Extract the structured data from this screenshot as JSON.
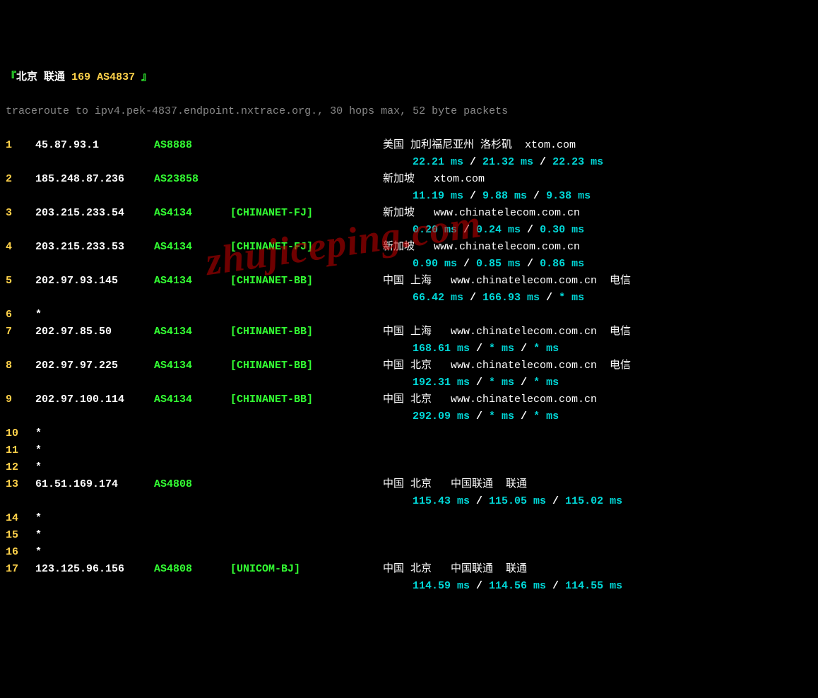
{
  "header": {
    "open": "『",
    "city": "北京",
    "isp": "联通",
    "asn_num": "169",
    "asn_label": "AS4837",
    "close": "』"
  },
  "cmd": "traceroute to ipv4.pek-4837.endpoint.nxtrace.org., 30 hops max, 52 byte packets",
  "watermark": "zhujiceping.com",
  "hops": [
    {
      "n": "1",
      "ip": "45.87.93.1",
      "asn": "AS8888",
      "net": "",
      "loc": "美国 加利福尼亚州 洛杉矶  xtom.com",
      "rtt": [
        "22.21 ms",
        "21.32 ms",
        "22.23 ms"
      ]
    },
    {
      "n": "2",
      "ip": "185.248.87.236",
      "asn": "AS23858",
      "net": "",
      "loc": "新加坡   xtom.com",
      "rtt": [
        "11.19 ms",
        "9.88 ms",
        "9.38 ms"
      ]
    },
    {
      "n": "3",
      "ip": "203.215.233.54",
      "asn": "AS4134",
      "net": "[CHINANET-FJ]",
      "loc": "新加坡   www.chinatelecom.com.cn",
      "rtt": [
        "0.20 ms",
        "0.24 ms",
        "0.30 ms"
      ]
    },
    {
      "n": "4",
      "ip": "203.215.233.53",
      "asn": "AS4134",
      "net": "[CHINANET-FJ]",
      "loc": "新加坡   www.chinatelecom.com.cn",
      "rtt": [
        "0.90 ms",
        "0.85 ms",
        "0.86 ms"
      ]
    },
    {
      "n": "5",
      "ip": "202.97.93.145",
      "asn": "AS4134",
      "net": "[CHINANET-BB]",
      "loc": "中国 上海   www.chinatelecom.com.cn  电信",
      "rtt": [
        "66.42 ms",
        "166.93 ms",
        "* ms"
      ]
    },
    {
      "n": "6",
      "ip": "*",
      "asn": "",
      "net": "",
      "loc": "",
      "rtt": null
    },
    {
      "n": "7",
      "ip": "202.97.85.50",
      "asn": "AS4134",
      "net": "[CHINANET-BB]",
      "loc": "中国 上海   www.chinatelecom.com.cn  电信",
      "rtt": [
        "168.61 ms",
        "* ms",
        "* ms"
      ]
    },
    {
      "n": "8",
      "ip": "202.97.97.225",
      "asn": "AS4134",
      "net": "[CHINANET-BB]",
      "loc": "中国 北京   www.chinatelecom.com.cn  电信",
      "rtt": [
        "192.31 ms",
        "* ms",
        "* ms"
      ]
    },
    {
      "n": "9",
      "ip": "202.97.100.114",
      "asn": "AS4134",
      "net": "[CHINANET-BB]",
      "loc": "中国 北京   www.chinatelecom.com.cn",
      "rtt": [
        "292.09 ms",
        "* ms",
        "* ms"
      ]
    },
    {
      "n": "10",
      "ip": "*",
      "asn": "",
      "net": "",
      "loc": "",
      "rtt": null
    },
    {
      "n": "11",
      "ip": "*",
      "asn": "",
      "net": "",
      "loc": "",
      "rtt": null
    },
    {
      "n": "12",
      "ip": "*",
      "asn": "",
      "net": "",
      "loc": "",
      "rtt": null
    },
    {
      "n": "13",
      "ip": "61.51.169.174",
      "asn": "AS4808",
      "net": "",
      "loc": "中国 北京   中国联通  联通",
      "rtt": [
        "115.43 ms",
        "115.05 ms",
        "115.02 ms"
      ]
    },
    {
      "n": "14",
      "ip": "*",
      "asn": "",
      "net": "",
      "loc": "",
      "rtt": null
    },
    {
      "n": "15",
      "ip": "*",
      "asn": "",
      "net": "",
      "loc": "",
      "rtt": null
    },
    {
      "n": "16",
      "ip": "*",
      "asn": "",
      "net": "",
      "loc": "",
      "rtt": null
    },
    {
      "n": "17",
      "ip": "123.125.96.156",
      "asn": "AS4808",
      "net": "[UNICOM-BJ]",
      "loc": "中国 北京   中国联通  联通",
      "rtt": [
        "114.59 ms",
        "114.56 ms",
        "114.55 ms"
      ]
    }
  ]
}
